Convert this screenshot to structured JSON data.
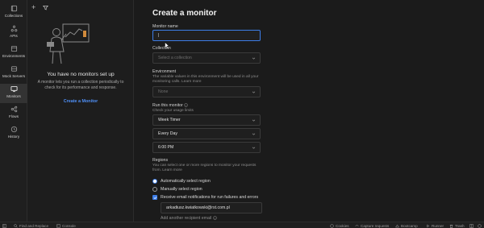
{
  "rail": {
    "items": [
      {
        "label": "Collections",
        "icon": "collections-icon"
      },
      {
        "label": "APIs",
        "icon": "apis-icon"
      },
      {
        "label": "Environments",
        "icon": "environments-icon"
      },
      {
        "label": "Mock Servers",
        "icon": "mock-servers-icon"
      },
      {
        "label": "Monitors",
        "icon": "monitors-icon"
      },
      {
        "label": "Flows",
        "icon": "flows-icon"
      },
      {
        "label": "History",
        "icon": "history-icon"
      }
    ],
    "active": "Monitors"
  },
  "panel": {
    "add_icon": "plus-icon",
    "filter_icon": "filter-icon",
    "empty_title": "You have no monitors set up",
    "empty_desc": "A monitor lets you run a collection periodically to check for its performance and response.",
    "create_link": "Create a Monitor"
  },
  "form": {
    "title": "Create a monitor",
    "name_label": "Monitor name",
    "name_value": "|",
    "collection_label": "Collection",
    "collection_placeholder": "Select a collection",
    "environment_label": "Environment",
    "environment_help": "The variable values in this environment will be used in all your monitoring calls. Learn more",
    "environment_value": "None",
    "run_label": "Run this monitor",
    "run_help": "Check your usage limits",
    "timer_value": "Week Timer",
    "day_value": "Every Day",
    "time_value": "6:00 PM",
    "regions_label": "Regions",
    "regions_help": "You can select one or more regions to monitor your requests from. Learn more",
    "auto_region": "Automatically select region",
    "manual_region": "Manually select region",
    "email_notify": "Receive email notifications for run failures and errors",
    "email_value": "arkadiusz.kwiatkowski@rst.com.pl",
    "add_recipient": "Add another recipient email"
  },
  "status_bar": {
    "find_replace": "Find and Replace",
    "console": "Console",
    "cookies": "Cookies",
    "capture": "Capture requests",
    "bootcamp": "Bootcamp",
    "runner": "Runner",
    "trash": "Trash"
  },
  "colors": {
    "accent": "#3d7de6",
    "link": "#4f8ff6",
    "background": "#1b1b1b"
  }
}
